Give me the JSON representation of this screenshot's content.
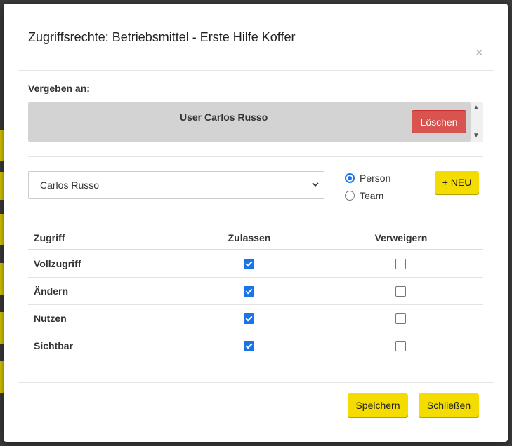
{
  "modal": {
    "title": "Zugriffsrechte: Betriebsmittel - Erste Hilfe Koffer",
    "close_label": "×"
  },
  "assign": {
    "label": "Vergeben an:",
    "entries": [
      {
        "user": "User Carlos Russo",
        "delete_label": "Löschen"
      }
    ]
  },
  "selector": {
    "selected_value": "Carlos Russo",
    "radio_options": [
      {
        "label": "Person",
        "checked": true
      },
      {
        "label": "Team",
        "checked": false
      }
    ],
    "new_button_label": "+ NEU"
  },
  "permissions": {
    "headers": [
      "Zugriff",
      "Zulassen",
      "Verweigern"
    ],
    "rows": [
      {
        "name": "Vollzugriff",
        "allow": true,
        "deny": false
      },
      {
        "name": "Ändern",
        "allow": true,
        "deny": false
      },
      {
        "name": "Nutzen",
        "allow": true,
        "deny": false
      },
      {
        "name": "Sichtbar",
        "allow": true,
        "deny": false
      }
    ]
  },
  "footer": {
    "save_label": "Speichern",
    "close_label": "Schließen"
  },
  "colors": {
    "primary_yellow": "#f5dc00",
    "danger_red": "#d9534f",
    "checkbox_blue": "#1a73e8"
  }
}
